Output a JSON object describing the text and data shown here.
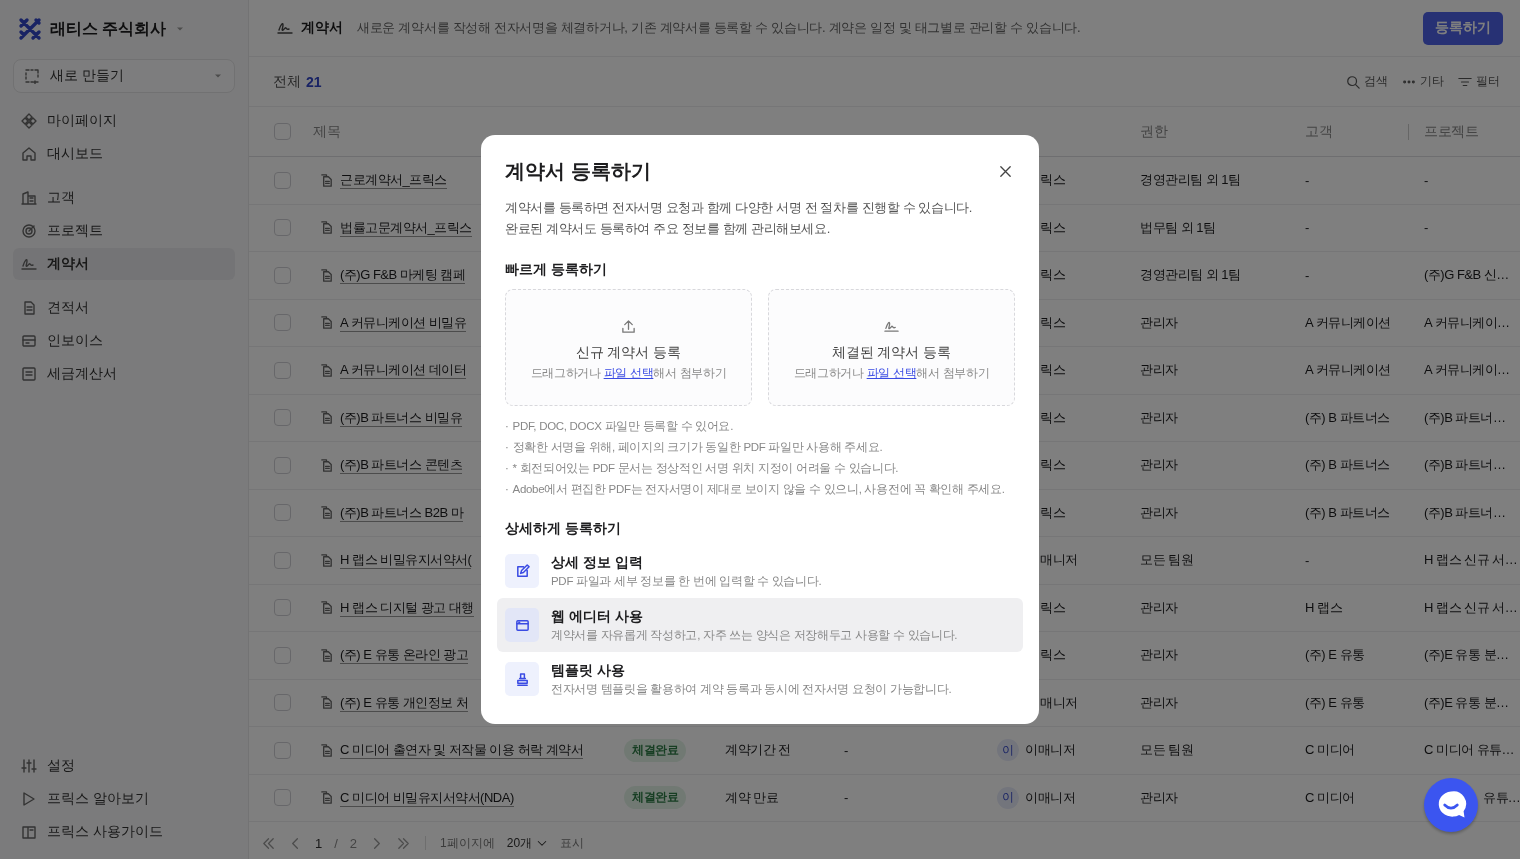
{
  "sidebar": {
    "company": "래티스 주식회사",
    "new_button": "새로 만들기",
    "groups": [
      [
        {
          "label": "마이페이지",
          "selected": false
        },
        {
          "label": "대시보드",
          "selected": false
        }
      ],
      [
        {
          "label": "고객",
          "selected": false
        },
        {
          "label": "프로젝트",
          "selected": false
        },
        {
          "label": "계약서",
          "selected": true
        }
      ],
      [
        {
          "label": "견적서",
          "selected": false
        },
        {
          "label": "인보이스",
          "selected": false
        },
        {
          "label": "세금계산서",
          "selected": false
        }
      ]
    ],
    "bottom_items": [
      {
        "label": "설정"
      },
      {
        "label": "프릭스 알아보기"
      },
      {
        "label": "프릭스 사용가이드"
      }
    ]
  },
  "header": {
    "title": "계약서",
    "description": "새로운 계약서를 작성해 전자서명을 체결하거나, 기존 계약서를 등록할 수 있습니다. 계약은 일정 및 태그별로 관리할 수 있습니다.",
    "register_button": "등록하기"
  },
  "toolbar": {
    "total_label": "전체",
    "total_count": "21",
    "tools": [
      "검색",
      "기타",
      "필터"
    ]
  },
  "table": {
    "select_all_checked": false,
    "columns": {
      "title": "제목",
      "auth": "권한",
      "client": "고객",
      "project": "프로젝트"
    },
    "rows": [
      {
        "checked": false,
        "title": "근로계약서_프릭스",
        "manager": "릭스",
        "auth": "경영관리팀 외 1팀",
        "client": "-",
        "project": "-"
      },
      {
        "checked": false,
        "title": "법률고문계약서_프릭스",
        "manager": "릭스",
        "auth": "법무팀 외 1팀",
        "client": "-",
        "project": "-"
      },
      {
        "checked": false,
        "title": "(주)G F&B 마케팅 캠페",
        "manager": "릭스",
        "auth": "경영관리팀 외 1팀",
        "client": "-",
        "project": "(주)G F&B 신…"
      },
      {
        "checked": false,
        "title": "A 커뮤니케이션 비밀유",
        "manager": "릭스",
        "auth": "관리자",
        "client": "A 커뮤니케이션",
        "project": "A 커뮤니케이…"
      },
      {
        "checked": false,
        "title": "A 커뮤니케이션 데이터",
        "manager": "릭스",
        "auth": "관리자",
        "client": "A 커뮤니케이션",
        "project": "A 커뮤니케이…"
      },
      {
        "checked": false,
        "title": "(주)B 파트너스 비밀유",
        "manager": "릭스",
        "auth": "관리자",
        "client": "(주) B 파트너스",
        "project": "(주)B 파트너…"
      },
      {
        "checked": false,
        "title": "(주)B 파트너스 콘텐츠",
        "manager": "릭스",
        "auth": "관리자",
        "client": "(주) B 파트너스",
        "project": "(주)B 파트너…"
      },
      {
        "checked": false,
        "title": "(주)B 파트너스 B2B 마",
        "manager": "릭스",
        "auth": "관리자",
        "client": "(주) B 파트너스",
        "project": "(주)B 파트너…"
      },
      {
        "checked": false,
        "title": "H 랩스 비밀유지서약서(",
        "manager": "매니저",
        "auth": "모든 팀원",
        "client": "-",
        "project": "H 랩스 신규 서…"
      },
      {
        "checked": false,
        "title": "H 랩스 디지털 광고 대행",
        "manager": "릭스",
        "auth": "관리자",
        "client": "H 랩스",
        "project": "H 랩스 신규 서…"
      },
      {
        "checked": false,
        "title": "(주) E 유통 온라인 광고",
        "manager": "릭스",
        "auth": "관리자",
        "client": "(주) E 유통",
        "project": "(주)E 유통 분…"
      },
      {
        "checked": false,
        "title": "(주) E 유통 개인정보 처",
        "manager": "매니저",
        "auth": "관리자",
        "client": "(주) E 유통",
        "project": "(주)E 유통 분…"
      },
      {
        "checked": false,
        "title": "C 미디어 출연자 및 저작물 이용 허락 계약서",
        "status": "체결완료",
        "period": "계약기간 전",
        "column_5": "-",
        "manager_initial": "이",
        "manager": "이매니저",
        "auth": "모든 팀원",
        "client": "C 미디어",
        "project": "C 미디어 유튜…"
      },
      {
        "checked": false,
        "title": "C 미디어 비밀유지서약서(NDA)",
        "status": "체결완료",
        "period": "계약 만료",
        "column_5": "-",
        "manager_initial": "이",
        "manager": "이매니저",
        "auth": "관리자",
        "client": "C 미디어",
        "project": "유튜…"
      }
    ]
  },
  "pagination": {
    "page": "1",
    "separator": "/",
    "total_pages": "2",
    "per_page_label": "1페이지에",
    "per_page": "20개",
    "suffix": "표시"
  },
  "modal": {
    "title": "계약서 등록하기",
    "description": [
      "계약서를 등록하면 전자서명 요청과 함께 다양한 서명 전 절차를 진행할 수 있습니다.",
      "완료된 계약서도 등록하여 주요 정보를 함께 관리해보세요."
    ],
    "quick_title": "빠르게 등록하기",
    "dropzones": [
      {
        "title": "신규 계약서 등록",
        "hint_before": "드래그하거나 ",
        "link": "파일 선택",
        "hint_after": "해서 첨부하기"
      },
      {
        "title": "체결된 계약서 등록",
        "hint_before": "드래그하거나 ",
        "link": "파일 선택",
        "hint_after": "해서 첨부하기"
      }
    ],
    "notes": [
      "PDF, DOC, DOCX 파일만 등록할 수 있어요.",
      "정확한 서명을 위해, 페이지의 크기가 동일한 PDF 파일만 사용해 주세요.",
      "* 회전되어있는 PDF 문서는 정상적인 서명 위치 지정이 어려울 수 있습니다.",
      "Adobe에서 편집한 PDF는 전자서명이 제대로 보이지 않을 수 있으니, 사용전에 꼭 확인해 주세요."
    ],
    "note_bullet": "·",
    "detail_title": "상세하게 등록하기",
    "options": [
      {
        "title": "상세 정보 입력",
        "description": "PDF 파일과 세부 정보를 한 번에 입력할 수 있습니다.",
        "selected": false
      },
      {
        "title": "웹 에디터 사용",
        "description": "계약서를 자유롭게 작성하고, 자주 쓰는 양식은 저장해두고 사용할 수 있습니다.",
        "selected": true
      },
      {
        "title": "템플릿 사용",
        "description": "전자서명 템플릿을 활용하여 계약 등록과 동시에 전자서명 요청이 가능합니다.",
        "selected": false
      }
    ]
  }
}
